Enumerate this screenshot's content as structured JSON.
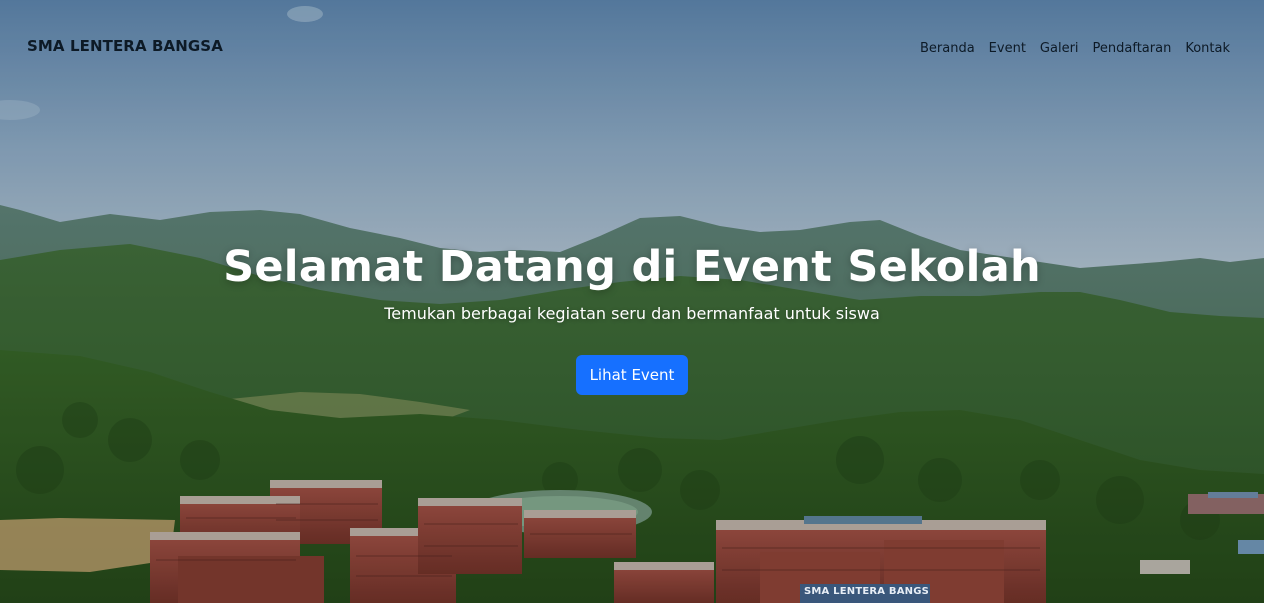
{
  "brand": {
    "name": "SMA LENTERA BANGSA"
  },
  "nav": {
    "items": [
      {
        "label": "Beranda"
      },
      {
        "label": "Event"
      },
      {
        "label": "Galeri"
      },
      {
        "label": "Pendaftaran"
      },
      {
        "label": "Kontak"
      }
    ]
  },
  "hero": {
    "title": "Selamat Datang di Event Sekolah",
    "subtitle": "Temukan berbagai kegiatan seru dan bermanfaat untuk siswa",
    "cta_label": "Lihat Event",
    "background_sign_text": "SMA LENTERA BANGSA"
  },
  "colors": {
    "accent": "#1670ff",
    "nav_text": "#0d1a26",
    "hero_text": "#ffffff"
  }
}
